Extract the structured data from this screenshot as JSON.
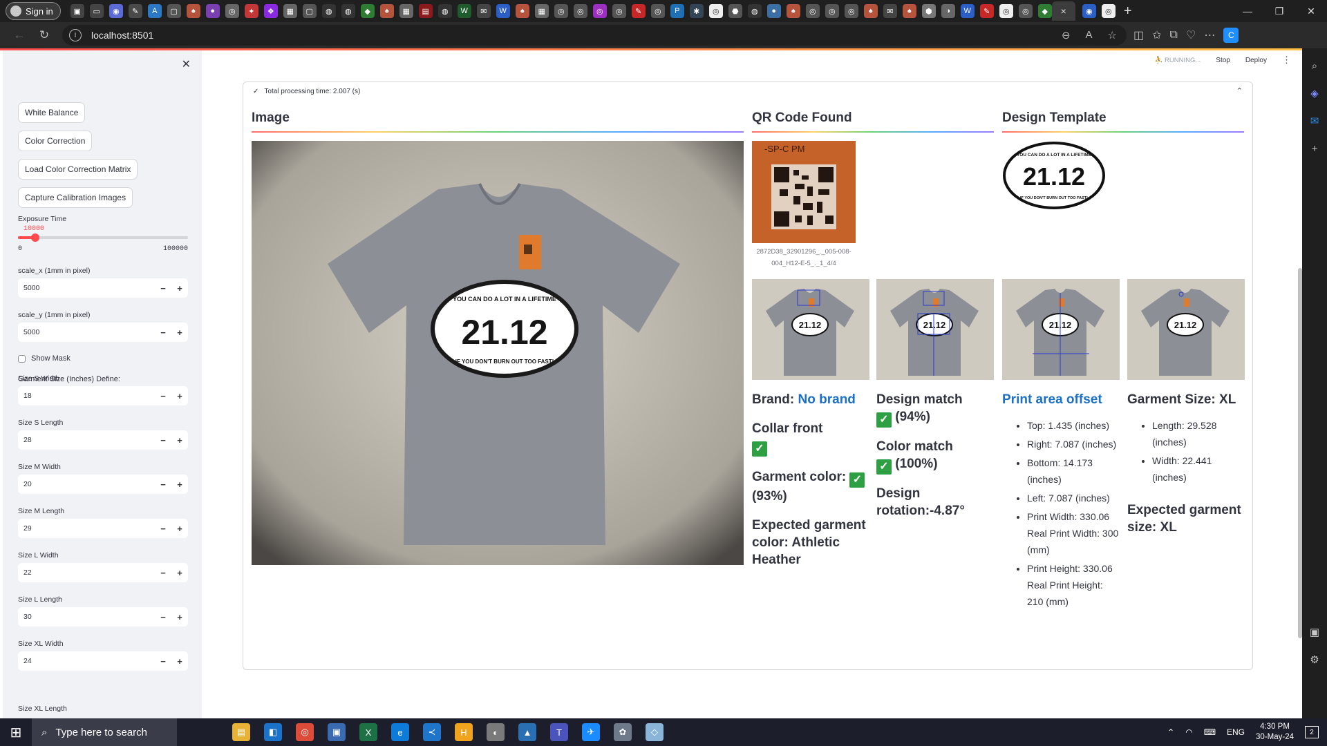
{
  "browser": {
    "profile_label": "Sign in",
    "url": "localhost:8501",
    "active_tab_close": "×",
    "window_controls": [
      "—",
      "❐",
      "✕"
    ]
  },
  "app_header": {
    "running_label": "RUNNING...",
    "stop_label": "Stop",
    "deploy_label": "Deploy",
    "menu_label": "⋮"
  },
  "sidebar": {
    "close_label": "✕",
    "buttons": [
      "White Balance",
      "Color Correction",
      "Load Color Correction Matrix",
      "Capture Calibration Images"
    ],
    "exposure": {
      "label": "Exposure Time",
      "value": "10000",
      "min": "0",
      "max": "100000",
      "fraction": 0.1
    },
    "scale_x": {
      "label": "scale_x (1mm in pixel)",
      "value": "5000"
    },
    "scale_y": {
      "label": "scale_y (1mm in pixel)",
      "value": "5000"
    },
    "show_mask": "Show Mask",
    "size_heading": "Garment Size (Inches) Define:",
    "sizes": [
      {
        "label": "Size S Width",
        "value": "18"
      },
      {
        "label": "Size S Length",
        "value": "28"
      },
      {
        "label": "Size M Width",
        "value": "20"
      },
      {
        "label": "Size M Length",
        "value": "29"
      },
      {
        "label": "Size L Width",
        "value": "22"
      },
      {
        "label": "Size L Length",
        "value": "30"
      },
      {
        "label": "Size XL Width",
        "value": "24"
      }
    ],
    "cutoff_label": "Size XL Length",
    "minus": "−",
    "plus": "+"
  },
  "main": {
    "status": "Total processing time: 2.007 (s)",
    "col_image": "Image",
    "col_qr": "QR Code Found",
    "col_design": "Design Template",
    "design_text_top": "YOU CAN DO A LOT IN A LIFETIME",
    "design_number": "21.12",
    "design_text_bottom": "IF YOU DON'T BURN OUT TOO FAST!",
    "qr_tag": "-SP-C    PM",
    "qr_caption": "2872D38_32901296_._005-008-004_H12-E-5_._1_4/4",
    "brand_label": "Brand:",
    "brand_value": "No brand",
    "collar_front": "Collar front",
    "garment_color_label": "Garment color:",
    "garment_color_pct": "(93%)",
    "expected_color": "Expected garment color: Athletic Heather",
    "design_match_label": "Design match",
    "design_match_pct": "(94%)",
    "color_match_label": "Color match",
    "color_match_pct": "(100%)",
    "design_rotation": "Design rotation:-4.87°",
    "print_area_title": "Print area offset",
    "print_area": [
      "Top: 1.435 (inches)",
      "Right: 7.087 (inches)",
      "Bottom: 14.173 (inches)",
      "Left: 7.087 (inches)",
      "Print Width: 330.06 Real Print Width: 300 (mm)",
      "Print Height: 330.06 Real Print Height: 210 (mm)"
    ],
    "garment_size_title": "Garment Size: XL",
    "garment_size": [
      "Length: 29.528 (inches)",
      "Width: 22.441 (inches)"
    ],
    "expected_size": "Expected garment size: XL",
    "check_glyph": "✓"
  },
  "taskbar": {
    "search_placeholder": "Type here to search",
    "lang": "ENG",
    "time": "4:30 PM",
    "date": "30-May-24",
    "notif_count": "2"
  },
  "colors": {
    "accent": "#ff4b4b",
    "brand_blue": "#1c70c5",
    "check_green": "#2ea043",
    "shirt": "#8c8f96",
    "table": "#cfcac0"
  }
}
